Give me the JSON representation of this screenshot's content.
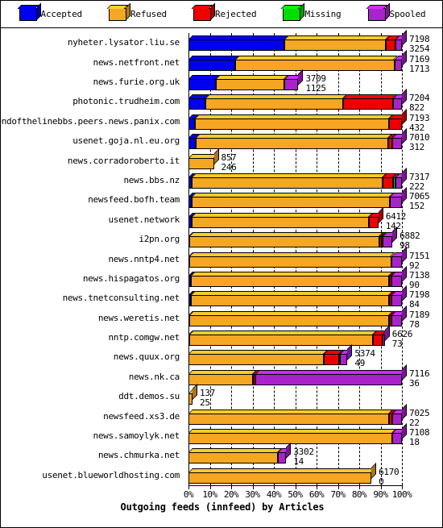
{
  "title": "Outgoing feeds (innfeed) by Articles",
  "legend": {
    "items": [
      {
        "label": "Accepted",
        "color": "#0000ee",
        "icon": "cube-icon"
      },
      {
        "label": "Refused",
        "color": "#f5a623",
        "icon": "cube-icon"
      },
      {
        "label": "Rejected",
        "color": "#ee0000",
        "icon": "cube-icon"
      },
      {
        "label": "Missing",
        "color": "#00dd00",
        "icon": "cube-icon"
      },
      {
        "label": "Spooled",
        "color": "#aa22cc",
        "icon": "cube-icon"
      }
    ]
  },
  "xaxis": {
    "ticks": [
      "0%",
      "10%",
      "20%",
      "30%",
      "40%",
      "50%",
      "60%",
      "70%",
      "80%",
      "90%",
      "100%"
    ],
    "min": 0,
    "max": 100
  },
  "chart_data": {
    "type": "bar",
    "orientation": "horizontal",
    "stacked": true,
    "normalized_percent": true,
    "title": "Outgoing feeds (innfeed) by Articles",
    "xlabel": "",
    "ylabel": "",
    "xlim": [
      0,
      100
    ],
    "grid": true,
    "legend_position": "top",
    "series": [
      {
        "name": "Accepted",
        "color": "#0000ee"
      },
      {
        "name": "Refused",
        "color": "#f5a623"
      },
      {
        "name": "Rejected",
        "color": "#ee0000"
      },
      {
        "name": "Missing",
        "color": "#00dd00"
      },
      {
        "name": "Spooled",
        "color": "#aa22cc"
      }
    ],
    "categories": [
      "nyheter.lysator.liu.se",
      "news.netfront.net",
      "news.furie.org.uk",
      "photonic.trudheim.com",
      "endofthelinebbs.peers.news.panix.com",
      "usenet.goja.nl.eu.org",
      "news.corradoroberto.it",
      "news.bbs.nz",
      "newsfeed.bofh.team",
      "usenet.network",
      "i2pn.org",
      "news.nntp4.net",
      "news.hispagatos.org",
      "news.tnetconsulting.net",
      "news.weretis.net",
      "nntp.comgw.net",
      "news.quux.org",
      "news.nk.ca",
      "ddt.demos.su",
      "newsfeed.xs3.de",
      "news.samoylyk.net",
      "news.chmurka.net",
      "usenet.blueworldhosting.com"
    ],
    "rows": [
      {
        "label": "nyheter.lysator.liu.se",
        "total": 7198,
        "value2": 3254,
        "bar_pct": 100.0,
        "pcts": [
          45.0,
          47.6,
          4.4,
          0.0,
          3.0
        ]
      },
      {
        "label": "news.netfront.net",
        "total": 7169,
        "value2": 1713,
        "bar_pct": 100.0,
        "pcts": [
          22.0,
          74.5,
          0.0,
          0.0,
          3.5
        ]
      },
      {
        "label": "news.furie.org.uk",
        "total": 3709,
        "value2": 1125,
        "bar_pct": 51.5,
        "pcts": [
          13.0,
          32.0,
          0.0,
          0.0,
          6.5
        ]
      },
      {
        "label": "photonic.trudheim.com",
        "total": 7204,
        "value2": 822,
        "bar_pct": 100.0,
        "pcts": [
          8.0,
          64.5,
          23.5,
          0.0,
          4.0
        ]
      },
      {
        "label": "endofthelinebbs.peers.news.panix.com",
        "total": 7193,
        "value2": 432,
        "bar_pct": 100.0,
        "pcts": [
          3.0,
          91.0,
          6.0,
          0.0,
          0.0
        ]
      },
      {
        "label": "usenet.goja.nl.eu.org",
        "total": 7010,
        "value2": 312,
        "bar_pct": 100.0,
        "pcts": [
          3.5,
          90.0,
          2.0,
          0.0,
          4.5
        ]
      },
      {
        "label": "news.corradoroberto.it",
        "total": 857,
        "value2": 246,
        "bar_pct": 11.9,
        "pcts": [
          0.0,
          11.9,
          0.0,
          0.0,
          0.0
        ]
      },
      {
        "label": "news.bbs.nz",
        "total": 7317,
        "value2": 222,
        "bar_pct": 100.0,
        "pcts": [
          1.5,
          89.5,
          5.0,
          1.0,
          3.0
        ]
      },
      {
        "label": "newsfeed.bofh.team",
        "total": 7065,
        "value2": 152,
        "bar_pct": 100.0,
        "pcts": [
          1.5,
          93.0,
          0.0,
          0.0,
          5.5
        ]
      },
      {
        "label": "usenet.network",
        "total": 6412,
        "value2": 142,
        "bar_pct": 89.0,
        "pcts": [
          1.5,
          83.0,
          4.5,
          0.0,
          0.0
        ]
      },
      {
        "label": "i2pn.org",
        "total": 6882,
        "value2": 98,
        "bar_pct": 95.5,
        "pcts": [
          0.5,
          89.0,
          1.0,
          0.5,
          4.5
        ]
      },
      {
        "label": "news.nntp4.net",
        "total": 7151,
        "value2": 92,
        "bar_pct": 100.0,
        "pcts": [
          0.5,
          94.5,
          0.0,
          0.0,
          5.0
        ]
      },
      {
        "label": "news.hispagatos.org",
        "total": 7138,
        "value2": 90,
        "bar_pct": 100.0,
        "pcts": [
          1.0,
          93.0,
          1.0,
          0.0,
          5.0
        ]
      },
      {
        "label": "news.tnetconsulting.net",
        "total": 7198,
        "value2": 84,
        "bar_pct": 100.0,
        "pcts": [
          1.0,
          93.0,
          1.0,
          0.0,
          5.0
        ]
      },
      {
        "label": "news.weretis.net",
        "total": 7189,
        "value2": 78,
        "bar_pct": 100.0,
        "pcts": [
          0.5,
          93.5,
          1.0,
          0.0,
          5.0
        ]
      },
      {
        "label": "nntp.comgw.net",
        "total": 6626,
        "value2": 73,
        "bar_pct": 92.0,
        "pcts": [
          0.5,
          86.0,
          4.5,
          0.0,
          1.0
        ]
      },
      {
        "label": "news.quux.org",
        "total": 5374,
        "value2": 49,
        "bar_pct": 74.5,
        "pcts": [
          0.0,
          63.5,
          7.0,
          0.5,
          3.5
        ]
      },
      {
        "label": "news.nk.ca",
        "total": 7116,
        "value2": 36,
        "bar_pct": 100.0,
        "pcts": [
          0.0,
          30.0,
          1.5,
          0.0,
          68.5
        ]
      },
      {
        "label": "ddt.demos.su",
        "total": 137,
        "value2": 25,
        "bar_pct": 1.9,
        "pcts": [
          0.0,
          1.9,
          0.0,
          0.0,
          0.0
        ]
      },
      {
        "label": "newsfeed.xs3.de",
        "total": 7025,
        "value2": 22,
        "bar_pct": 100.0,
        "pcts": [
          0.0,
          94.0,
          1.5,
          0.0,
          4.5
        ]
      },
      {
        "label": "news.samoylyk.net",
        "total": 7108,
        "value2": 18,
        "bar_pct": 100.0,
        "pcts": [
          0.0,
          95.5,
          0.0,
          0.0,
          4.5
        ]
      },
      {
        "label": "news.chmurka.net",
        "total": 3302,
        "value2": 14,
        "bar_pct": 45.8,
        "pcts": [
          0.0,
          42.0,
          0.0,
          0.0,
          3.8
        ]
      },
      {
        "label": "usenet.blueworldhosting.com",
        "total": 6170,
        "value2": 0,
        "bar_pct": 85.7,
        "pcts": [
          0.0,
          85.7,
          0.0,
          0.0,
          0.0
        ]
      }
    ]
  }
}
